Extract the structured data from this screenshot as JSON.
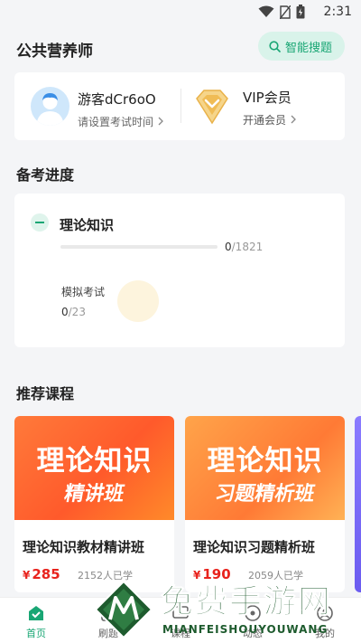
{
  "status_bar": {
    "time": "2:31"
  },
  "header": {
    "title": "公共营养师",
    "smart_search": "智能搜题"
  },
  "profile": {
    "user_name": "游客dCr6oO",
    "set_exam_time": "请设置考试时间",
    "vip_title": "VIP会员",
    "vip_open": "开通会员"
  },
  "progress_section": {
    "title": "备考进度",
    "subject": "理论知识",
    "done": "0",
    "total": "/1821",
    "progress_fraction": 0,
    "exam_label": "模拟考试",
    "exam_done": "0",
    "exam_total": "/23"
  },
  "courses_section": {
    "title": "推荐课程",
    "courses": [
      {
        "banner_main": "理论知识",
        "banner_sub": "精讲班",
        "title": "理论知识教材精讲班",
        "currency": "¥",
        "price": "285",
        "learners": "2152人已学"
      },
      {
        "banner_main": "理论知识",
        "banner_sub": "习题精析班",
        "title": "理论知识习题精析班",
        "currency": "¥",
        "price": "190",
        "learners": "2059人已学"
      }
    ]
  },
  "bottom_nav": [
    {
      "label": "首页",
      "icon": "home-icon",
      "active": true
    },
    {
      "label": "刷题",
      "icon": "quiz-icon",
      "active": false
    },
    {
      "label": "课程",
      "icon": "course-icon",
      "active": false
    },
    {
      "label": "动态",
      "icon": "feed-icon",
      "active": false
    },
    {
      "label": "我的",
      "icon": "profile-icon",
      "active": false
    }
  ],
  "watermark": {
    "cn": "免费手游网",
    "en": "MIANFEISHOUYOUWANG"
  },
  "colors": {
    "accent": "#19a674",
    "price": "#e8231d",
    "banner": "#ff5a2b"
  }
}
